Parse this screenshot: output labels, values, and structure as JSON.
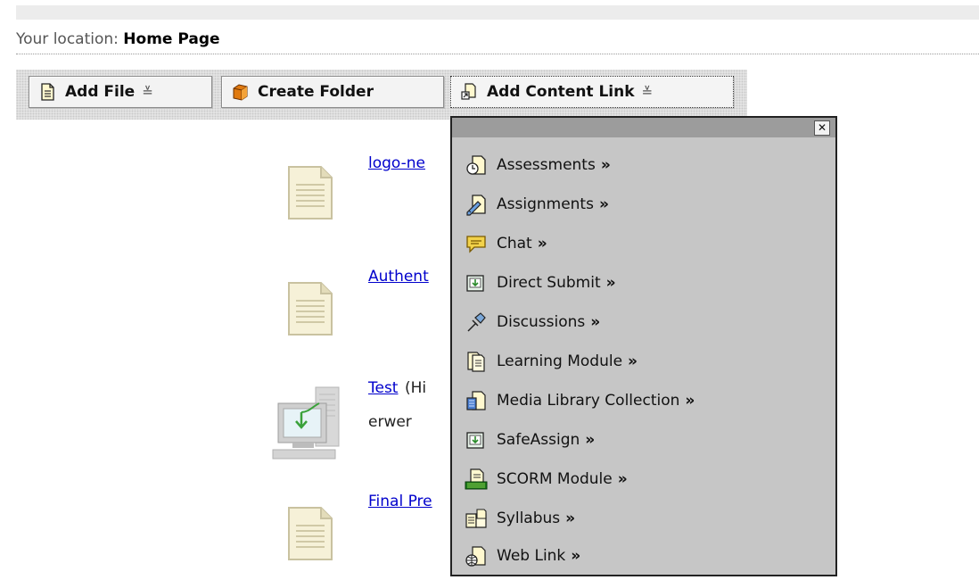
{
  "location": {
    "prefix": "Your location:",
    "current": "Home Page"
  },
  "toolbar": {
    "add_file": "Add File",
    "create_folder": "Create Folder",
    "add_content_link": "Add Content Link",
    "caret": "≚"
  },
  "content_items": [
    {
      "title": "logo-ne",
      "type": "document"
    },
    {
      "title": "Authent",
      "type": "document"
    },
    {
      "title": "Test",
      "after": "(Hi",
      "desc": "erwer",
      "type": "computer"
    },
    {
      "title": "Final Pre",
      "type": "document"
    }
  ],
  "menu": {
    "close": "✕",
    "arrow": "»",
    "items": [
      {
        "label": "Assessments",
        "icon": "assessment-icon"
      },
      {
        "label": "Assignments",
        "icon": "assignment-icon"
      },
      {
        "label": "Chat",
        "icon": "chat-icon"
      },
      {
        "label": "Direct Submit",
        "icon": "direct-submit-icon"
      },
      {
        "label": "Discussions",
        "icon": "discussions-icon"
      },
      {
        "label": "Learning Module",
        "icon": "learning-module-icon"
      },
      {
        "label": "Media Library Collection",
        "icon": "media-library-icon"
      },
      {
        "label": "SafeAssign",
        "icon": "safeassign-icon"
      },
      {
        "label": "SCORM Module",
        "icon": "scorm-icon"
      },
      {
        "label": "Syllabus",
        "icon": "syllabus-icon"
      },
      {
        "label": "Web Link",
        "icon": "web-link-icon"
      }
    ]
  }
}
